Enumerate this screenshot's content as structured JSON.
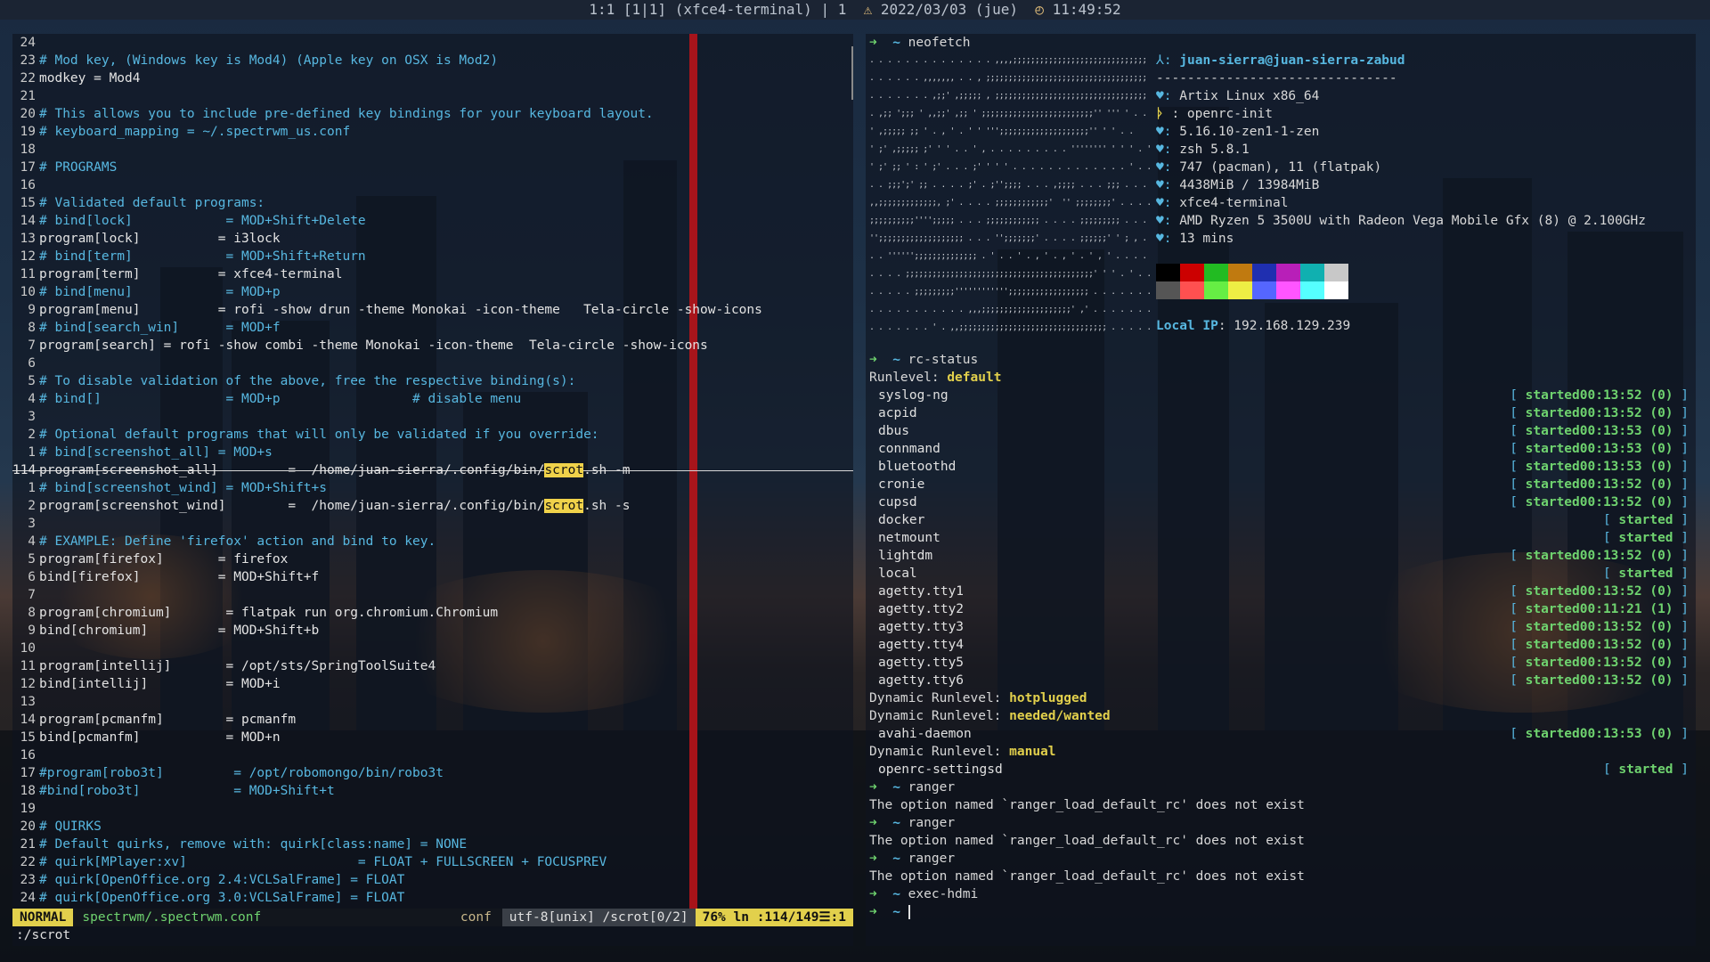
{
  "topbar": {
    "workspace": "1:1 [1|1] (xfce4-terminal) | 1",
    "warn_icon": "warning-icon",
    "date": "2022/03/03 (jue)",
    "clock_icon": "clock-icon",
    "time": "11:49:52"
  },
  "editor": {
    "lines": [
      {
        "n": "24",
        "c": "",
        "t": ""
      },
      {
        "n": "23",
        "c": "# Mod key, (Windows key is Mod4) (Apple key on OSX is Mod2)",
        "t": ""
      },
      {
        "n": "22",
        "c": "",
        "t": "modkey = Mod4"
      },
      {
        "n": "21",
        "c": "",
        "t": ""
      },
      {
        "n": "20",
        "c": "# This allows you to include pre-defined key bindings for your keyboard layout.",
        "t": ""
      },
      {
        "n": "19",
        "c": "# keyboard_mapping = ~/.spectrwm_us.conf",
        "t": ""
      },
      {
        "n": "18",
        "c": "",
        "t": ""
      },
      {
        "n": "17",
        "c": "# PROGRAMS",
        "t": ""
      },
      {
        "n": "16",
        "c": "",
        "t": ""
      },
      {
        "n": "15",
        "c": "# Validated default programs:",
        "t": ""
      },
      {
        "n": "14",
        "c": "# bind[lock]            = MOD+Shift+Delete",
        "t": ""
      },
      {
        "n": "13",
        "c": "",
        "t": "program[lock]          = i3lock"
      },
      {
        "n": "12",
        "c": "# bind[term]            = MOD+Shift+Return",
        "t": ""
      },
      {
        "n": "11",
        "c": "",
        "t": "program[term]          = xfce4-terminal"
      },
      {
        "n": "10",
        "c": "# bind[menu]            = MOD+p",
        "t": ""
      },
      {
        "n": "9",
        "c": "",
        "t": "program[menu]          = rofi -show drun -theme Monokai -icon-theme   Tela-circle -show-icons"
      },
      {
        "n": "8",
        "c": "# bind[search_win]      = MOD+f",
        "t": ""
      },
      {
        "n": "7",
        "c": "",
        "t": "program[search] = rofi -show combi -theme Monokai -icon-theme  Tela-circle -show-icons"
      },
      {
        "n": "6",
        "c": "",
        "t": ""
      },
      {
        "n": "5",
        "c": "# To disable validation of the above, free the respective binding(s):",
        "t": ""
      },
      {
        "n": "4",
        "c": "# bind[]                = MOD+p                 # disable menu",
        "t": ""
      },
      {
        "n": "3",
        "c": "",
        "t": ""
      },
      {
        "n": "2",
        "c": "# Optional default programs that will only be validated if you override:",
        "t": ""
      },
      {
        "n": "1",
        "c": "# bind[screenshot_all] = MOD+s",
        "t": ""
      },
      {
        "n": "114",
        "c": "",
        "t": "",
        "pre": "program[screenshot_all]         =  /home/juan-sierra/.config/bin/",
        "hl": "scrot",
        "post": ".sh -m",
        "cur": true
      },
      {
        "n": "1",
        "c": "# bind[screenshot_wind] = MOD+Shift+s",
        "t": ""
      },
      {
        "n": "2",
        "c": "",
        "t": "",
        "pre": "program[screenshot_wind]        =  /home/juan-sierra/.config/bin/",
        "hl": "scrot",
        "post": ".sh -s"
      },
      {
        "n": "3",
        "c": "",
        "t": ""
      },
      {
        "n": "4",
        "c": "# EXAMPLE: Define 'firefox' action and bind to key.",
        "t": ""
      },
      {
        "n": "5",
        "c": "",
        "t": "program[firefox]       = firefox"
      },
      {
        "n": "6",
        "c": "",
        "t": "bind[firefox]          = MOD+Shift+f"
      },
      {
        "n": "7",
        "c": "",
        "t": ""
      },
      {
        "n": "8",
        "c": "",
        "t": "program[chromium]       = flatpak run org.chromium.Chromium"
      },
      {
        "n": "9",
        "c": "",
        "t": "bind[chromium]         = MOD+Shift+b"
      },
      {
        "n": "10",
        "c": "",
        "t": ""
      },
      {
        "n": "11",
        "c": "",
        "t": "program[intellij]       = /opt/sts/SpringToolSuite4"
      },
      {
        "n": "12",
        "c": "",
        "t": "bind[intellij]          = MOD+i"
      },
      {
        "n": "13",
        "c": "",
        "t": ""
      },
      {
        "n": "14",
        "c": "",
        "t": "program[pcmanfm]        = pcmanfm"
      },
      {
        "n": "15",
        "c": "",
        "t": "bind[pcmanfm]           = MOD+n"
      },
      {
        "n": "16",
        "c": "",
        "t": ""
      },
      {
        "n": "17",
        "c": "#program[robo3t]         = /opt/robomongo/bin/robo3t",
        "t": ""
      },
      {
        "n": "18",
        "c": "#bind[robo3t]            = MOD+Shift+t",
        "t": ""
      },
      {
        "n": "19",
        "c": "",
        "t": ""
      },
      {
        "n": "20",
        "c": "# QUIRKS",
        "t": ""
      },
      {
        "n": "21",
        "c": "# Default quirks, remove with: quirk[class:name] = NONE",
        "t": ""
      },
      {
        "n": "22",
        "c": "# quirk[MPlayer:xv]                      = FLOAT + FULLSCREEN + FOCUSPREV",
        "t": ""
      },
      {
        "n": "23",
        "c": "# quirk[OpenOffice.org 2.4:VCLSalFrame] = FLOAT",
        "t": ""
      },
      {
        "n": "24",
        "c": "# quirk[OpenOffice.org 3.0:VCLSalFrame] = FLOAT",
        "t": ""
      }
    ],
    "status": {
      "mode": "NORMAL",
      "file": "spectrwm/.spectrwm.conf",
      "filetype": "conf",
      "encoding": "utf-8[unix] /scrot[0/2]",
      "position": "76% ln :114/149☰:1"
    },
    "cmdline": ":/scrot"
  },
  "terminal": {
    "prompt": "~",
    "cmd_neofetch": "neofetch",
    "ascii": [
      ". . . . . . . . . . . . . . ,,,,;;;;;;;;;;;;;;;;;;;;;;;;;;;;;; . . . .",
      ". . . . . . ,,,,,,, . . , ;;;;;;;;;;;;;;;;;;;;;;;;;;;;;;;;;;;; . . . .",
      ". . . . . . . ,;;' ,;;;;; , ;;;;;;;;;;;;;;;;;;;;;;;;;;;;;;;;;; . . . .",
      ". ,;; ';;; ' ,,;;' ,;; ' ;;;;;;;;;;;;;;;;;;;;;;;;;'' ''' ' . .",
      "' ,;;;;; ;; ' . , ' . ' ' ''';;;;;;;;;;;;;;;;;;;;'' ' ' . .",
      "' ;' ,;;;;; ;' ' ' . . ' , . . . . . . . . . '''''''' ' ' ' . ' . ,",
      "' ;' ;; ' : ' ;' . . . ;' ' ' ' . . . . . . . . . . . . . ' . . . .",
      ". . ;;;';' ;; . . . . ;' . ;'';;;; . . . ,;;;; . . . ;;; . . . .",
      ",,;;;;;;;;;;;;;, ;' . . . . ;;;;;;;;;;;;'  '' ;;;;;;;;' . . . .",
      ";;;;;;;;;;'''';;;;; . . . ;;;;;;;;;;;; . . . . ;;;;;;;;; . . . . .",
      "'';;;;;;;;;;;;;;;;;;; . . . '';;;;;;;' . . . . ;;;;;;' ' ; , . . . .",
      ". . '''''';;;;;;;;;;;;;; . ' . . ' . , ' . , ' . ' , ' . . . . .",
      ". . . . ;;;;;;;;;;;;;;;;;;;;;;;;;;;;;;;;;;;;;;;;;;' ' ' . ' . . . .",
      ". . . . . ;;;;;;;;;'''''''''''';;;;;;;;;;;;;;;;;; . . . . . . . . . .",
      ". . . . . . . . . . . ,,,;;;;;;;;;;;;;;;;;;;;' ,' . . . . . . . . .",
      ". . . . . . . ' . ,,;;;;;;;;;;;;;;;;;;;;;;;;;;;;;;;;; . . . . . . ."
    ],
    "neofetch": {
      "user_host": "juan-sierra@juan-sierra-zabud",
      "separator": "-------------------------------",
      "os": "Artix Linux x86_64",
      "init": ": openrc-init",
      "kernel": "5.16.10-zen1-1-zen",
      "shell": "zsh 5.8.1",
      "packages": "747 (pacman), 11 (flatpak)",
      "memory": "4438MiB / 13984MiB",
      "terminal": "xfce4-terminal",
      "cpu": "AMD Ryzen 5 3500U with Radeon Vega Mobile Gfx (8) @ 2.100GHz",
      "uptime": "13 mins",
      "palette_top": [
        "#000000",
        "#cc0000",
        "#22bb22",
        "#c07a10",
        "#1f2fb0",
        "#b81fb8",
        "#10b0b0",
        "#c8c8c8"
      ],
      "palette_bottom": [
        "#555555",
        "#ff5050",
        "#66ee44",
        "#eeee44",
        "#5566ff",
        "#ff55ff",
        "#55ffff",
        "#ffffff"
      ],
      "local_ip_label": "Local IP",
      "local_ip": ": 192.168.129.239"
    },
    "cmd_rcstatus": "rc-status",
    "runlevel_label": "Runlevel: ",
    "runlevel": "default",
    "services": [
      {
        "name": "syslog-ng",
        "state": "started",
        "time": "00:13:52 (0)"
      },
      {
        "name": "acpid",
        "state": "started",
        "time": "00:13:52 (0)"
      },
      {
        "name": "dbus",
        "state": "started",
        "time": "00:13:53 (0)"
      },
      {
        "name": "connmand",
        "state": "started",
        "time": "00:13:53 (0)"
      },
      {
        "name": "bluetoothd",
        "state": "started",
        "time": "00:13:53 (0)"
      },
      {
        "name": "cronie",
        "state": "started",
        "time": "00:13:52 (0)"
      },
      {
        "name": "cupsd",
        "state": "started",
        "time": "00:13:52 (0)"
      },
      {
        "name": "docker",
        "state": "started",
        "time": ""
      },
      {
        "name": "netmount",
        "state": "started",
        "time": ""
      },
      {
        "name": "lightdm",
        "state": "started",
        "time": "00:13:52 (0)"
      },
      {
        "name": "local",
        "state": "started",
        "time": ""
      },
      {
        "name": "agetty.tty1",
        "state": "started",
        "time": "00:13:52 (0)"
      },
      {
        "name": "agetty.tty2",
        "state": "started",
        "time": "00:11:21 (1)"
      },
      {
        "name": "agetty.tty3",
        "state": "started",
        "time": "00:13:52 (0)"
      },
      {
        "name": "agetty.tty4",
        "state": "started",
        "time": "00:13:52 (0)"
      },
      {
        "name": "agetty.tty5",
        "state": "started",
        "time": "00:13:52 (0)"
      },
      {
        "name": "agetty.tty6",
        "state": "started",
        "time": "00:13:52 (0)"
      }
    ],
    "dyn1_label": "Dynamic Runlevel: ",
    "dyn1": "hotplugged",
    "dyn2_label": "Dynamic Runlevel: ",
    "dyn2": "needed/wanted",
    "dyn2_services": [
      {
        "name": "avahi-daemon",
        "state": "started",
        "time": "00:13:53 (0)"
      }
    ],
    "dyn3_label": "Dynamic Runlevel: ",
    "dyn3": "manual",
    "dyn3_services": [
      {
        "name": "openrc-settingsd",
        "state": "started",
        "time": ""
      }
    ],
    "cmd_ranger": "ranger",
    "ranger_err": "The option named `ranger_load_default_rc' does not exist",
    "cmd_exec": "exec-hdmi"
  }
}
